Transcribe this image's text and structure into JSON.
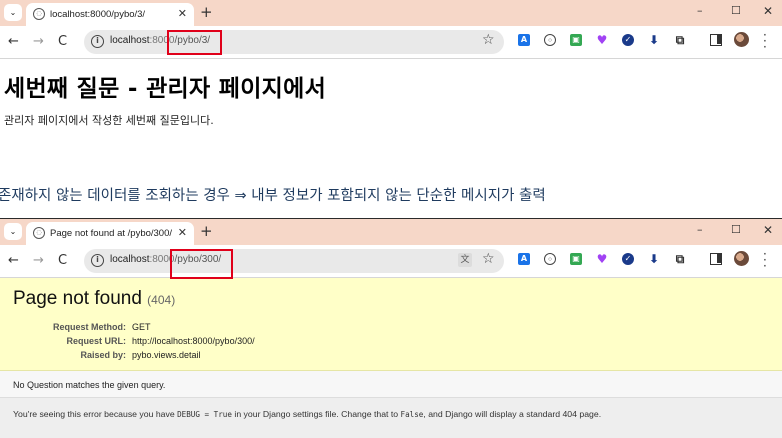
{
  "window1": {
    "tab_title": "localhost:8000/pybo/3/",
    "url_host": "localhost",
    "url_port": ":8000",
    "url_path": "/pybo/3/",
    "heading": "세번째 질문 - 관리자 페이지에서",
    "body_text": "관리자 페이지에서 작성한 세번째 질문입니다.",
    "caption": "존재하지 않는 데이터를 조회하는 경우 ⇒ 내부 정보가 포함되지 않는 단순한 메시지가 출력"
  },
  "window2": {
    "tab_title": "Page not found at /pybo/300/",
    "url_host": "localhost",
    "url_port": ":8000",
    "url_path": "/pybo/300/",
    "error_title": "Page not found",
    "error_code": "(404)",
    "request_method_label": "Request Method:",
    "request_method_value": "GET",
    "request_url_label": "Request URL:",
    "request_url_value": "http://localhost:8000/pybo/300/",
    "raised_by_label": "Raised by:",
    "raised_by_value": "pybo.views.detail",
    "summary": "No Question matches the given query.",
    "explanation_part1": "You're seeing this error because you have ",
    "explanation_code1": "DEBUG = True",
    "explanation_part2": " in your Django settings file. Change that to ",
    "explanation_code2": "False",
    "explanation_part3": ", and Django will display a standard 404 page."
  },
  "browser": {
    "new_tab_glyph": "+",
    "close_tab_glyph": "✕",
    "minimize_glyph": "–",
    "maximize_glyph": "☐",
    "close_window_glyph": "✕"
  },
  "colors": {
    "tabstrip": "#f6d7c8",
    "highlight": "#e0001a",
    "error_banner": "#ffffc8",
    "caption_text": "#1f3b5f"
  }
}
